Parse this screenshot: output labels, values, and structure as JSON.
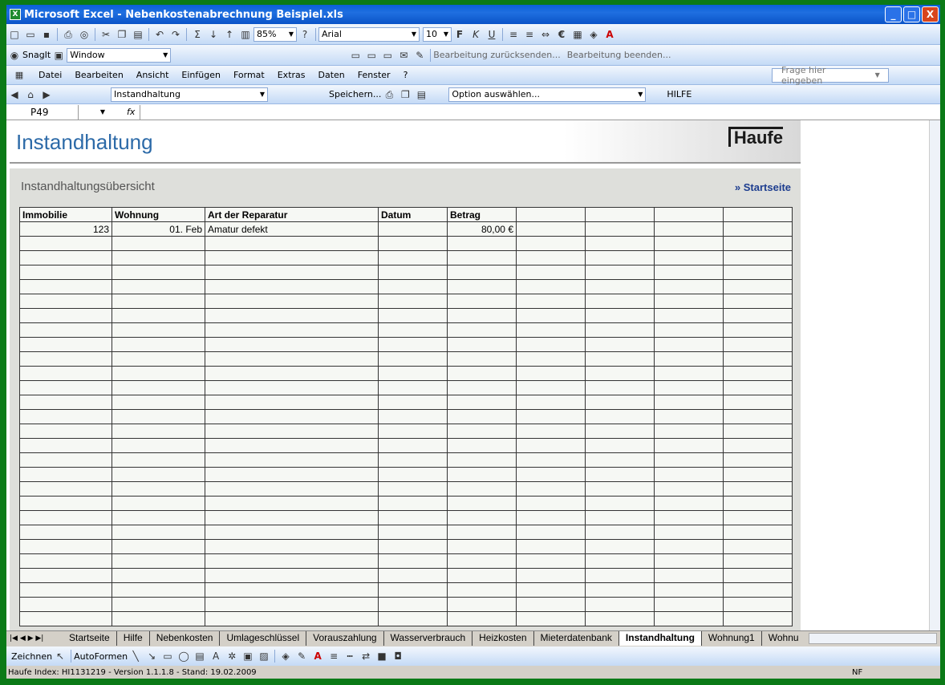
{
  "window": {
    "title": "Microsoft Excel - Nebenkostenabrechnung Beispiel.xls",
    "app_icon": "excel-icon",
    "min": "_",
    "max": "□",
    "close": "X"
  },
  "toolbar": {
    "zoom": "85%",
    "font": "Arial",
    "size": "10",
    "bold": "F",
    "italic": "K",
    "underline": "U",
    "euro": "€"
  },
  "snagit": {
    "label": "SnagIt",
    "combo": "Window",
    "review1": "Bearbeitung zurücksenden...",
    "review2": "Bearbeitung beenden..."
  },
  "menu": {
    "items": [
      "Datei",
      "Bearbeiten",
      "Ansicht",
      "Einfügen",
      "Format",
      "Extras",
      "Daten",
      "Fenster",
      "?"
    ],
    "help_placeholder": "Frage hier eingeben"
  },
  "nav": {
    "combo": "Instandhaltung",
    "save": "Speichern...",
    "option": "Option auswählen...",
    "help": "HILFE"
  },
  "formula": {
    "cell": "P49",
    "fx": "fx"
  },
  "sheet": {
    "title": "Instandhaltung",
    "logo": "Haufe",
    "subtitle": "Instandhaltungsübersicht",
    "link": "» Startseite",
    "headers": [
      "Immobilie",
      "Wohnung",
      "Art der Reparatur",
      "Datum",
      "Betrag",
      "",
      "",
      "",
      ""
    ],
    "row1": [
      "123",
      "01. Feb",
      "Amatur defekt",
      "",
      "80,00 €",
      "",
      "",
      "",
      ""
    ]
  },
  "tabs": [
    "Startseite",
    "Hilfe",
    "Nebenkosten",
    "Umlageschlüssel",
    "Vorauszahlung",
    "Wasserverbrauch",
    "Heizkosten",
    "Mieterdatenbank",
    "Instandhaltung",
    "Wohnung1",
    "Wohnu"
  ],
  "drawing": {
    "draw": "Zeichnen",
    "autoshapes": "AutoFormen"
  },
  "status": "Haufe Index: HI1131219 - Version 1.1.1.8 - Stand: 19.02.2009",
  "status_nf": "NF"
}
